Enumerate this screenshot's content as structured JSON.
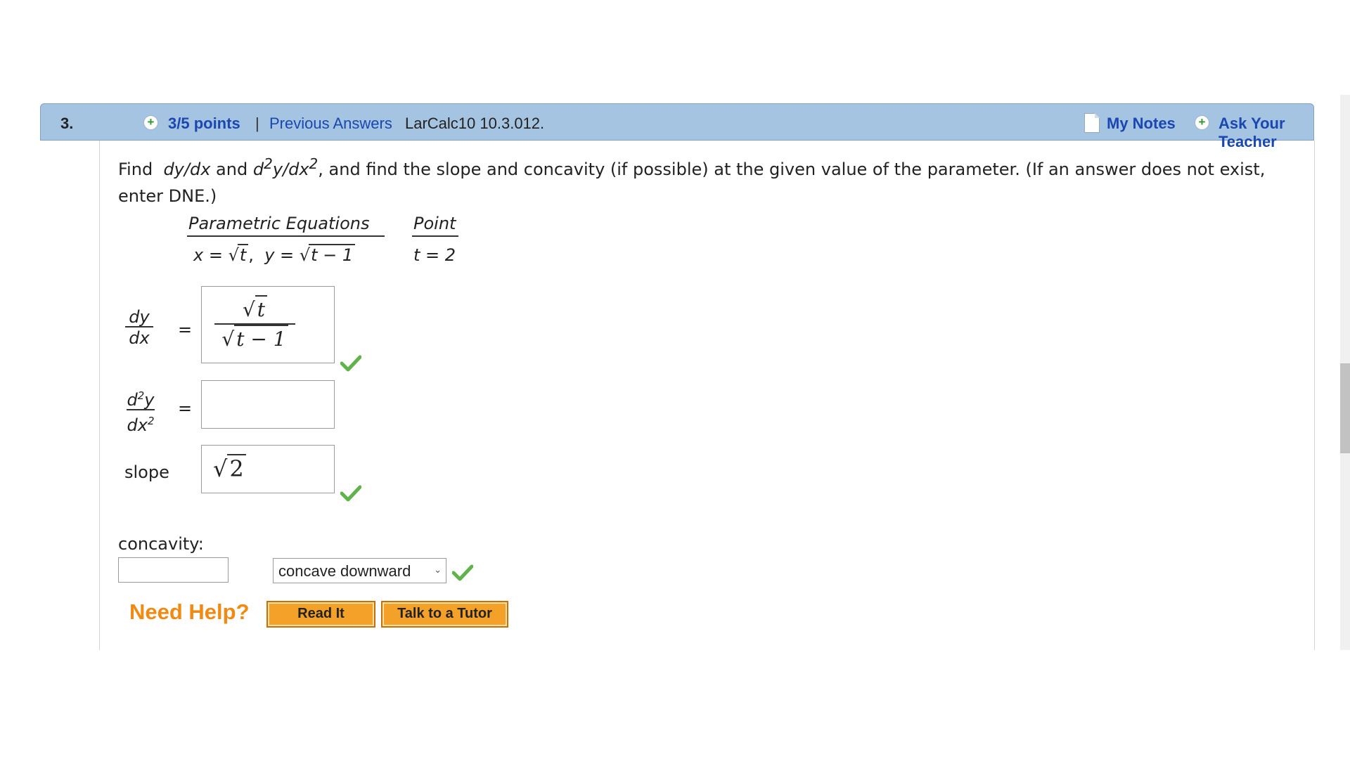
{
  "header": {
    "number": "3.",
    "points": "3/5 points",
    "separator": "|",
    "previous_answers": "Previous Answers",
    "code": "LarCalc10 10.3.012.",
    "my_notes": "My Notes",
    "ask_teacher": "Ask Your Teacher"
  },
  "question": {
    "w1": "Find",
    "t1": "dy/dx",
    "w2": "and",
    "t2a": "d",
    "t2sup1": "2",
    "t2b": "y/dx",
    "t2sup2": "2",
    "rest": ", and find the slope and concavity (if possible) at the given value of the parameter. (If an answer does not exist, enter DNE.)"
  },
  "table": {
    "header_equations": "Parametric Equations",
    "header_point": "Point",
    "eq_x_lhs": "x = ",
    "eq_x_rad": "t",
    "eq_sep": ", ",
    "eq_y_lhs": "y = ",
    "eq_y_rad": "t − 1",
    "point": "t = 2"
  },
  "answers": {
    "dydx": {
      "label_num": "dy",
      "label_den": "dx",
      "equals": "=",
      "num_rad": "t",
      "den_rad": "t − 1"
    },
    "d2ydx2": {
      "label_num_a": "d",
      "label_num_sup": "2",
      "label_num_b": "y",
      "label_den_a": "dx",
      "label_den_sup": "2",
      "equals": "="
    },
    "slope": {
      "label": "slope",
      "value_rad": "2"
    },
    "concavity": {
      "label": "concavity:",
      "selected": "concave downward"
    }
  },
  "help": {
    "title": "Need Help?",
    "read_it": "Read It",
    "talk_tutor": "Talk to a Tutor"
  },
  "colors": {
    "header_bg": "#a4c4e1",
    "link": "#1a47b0",
    "check": "#5fb34a",
    "help_title": "#f08a12",
    "button_bg": "#f4a12a"
  },
  "icons": {
    "points": "plus-circle-icon",
    "notes": "note-icon",
    "ask": "plus-circle-icon",
    "correct": "checkmark-icon",
    "dropdown": "chevron-down-icon"
  }
}
